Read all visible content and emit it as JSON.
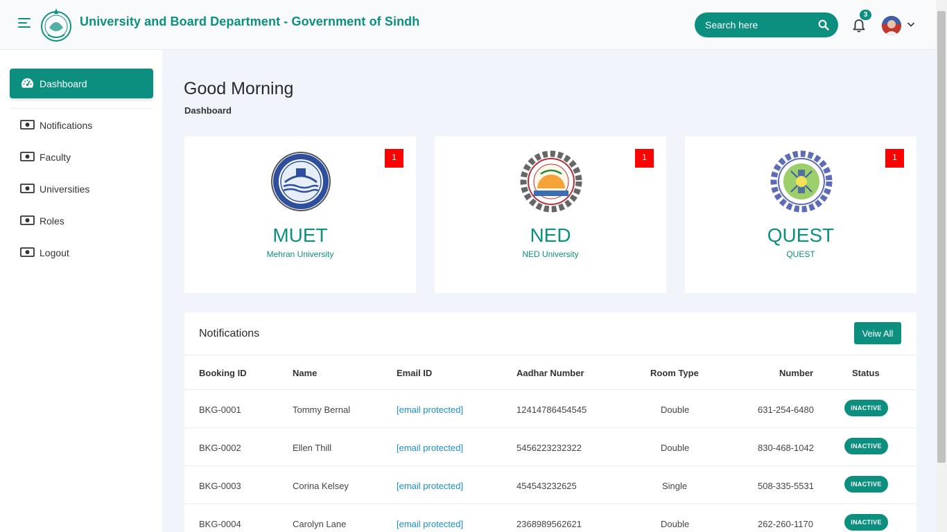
{
  "header": {
    "title": "University and Board Department - Government of Sindh",
    "search_placeholder": "Search here",
    "notification_count": "3"
  },
  "sidebar": {
    "items": [
      {
        "label": "Dashboard",
        "active": true
      },
      {
        "label": "Notifications"
      },
      {
        "label": "Faculty"
      },
      {
        "label": "Universities"
      },
      {
        "label": "Roles"
      },
      {
        "label": "Logout"
      }
    ]
  },
  "main": {
    "greeting": "Good Morning",
    "breadcrumb": "Dashboard"
  },
  "cards": [
    {
      "code": "MUET",
      "name": "Mehran University",
      "badge": "1"
    },
    {
      "code": "NED",
      "name": "NED University",
      "badge": "1"
    },
    {
      "code": "QUEST",
      "name": "QUEST",
      "badge": "1"
    }
  ],
  "notifications": {
    "title": "Notifications",
    "view_all": "Veiw All",
    "columns": [
      "Booking ID",
      "Name",
      "Email ID",
      "Aadhar Number",
      "Room Type",
      "Number",
      "Status"
    ],
    "rows": [
      [
        "BKG-0001",
        "Tommy Bernal",
        "[email protected]",
        "12414786454545",
        "Double",
        "631-254-6480",
        "INACTIVE"
      ],
      [
        "BKG-0002",
        "Ellen Thill",
        "[email protected]",
        "5456223232322",
        "Double",
        "830-468-1042",
        "INACTIVE"
      ],
      [
        "BKG-0003",
        "Corina Kelsey",
        "[email protected]",
        "454543232625",
        "Single",
        "508-335-5531",
        "INACTIVE"
      ],
      [
        "BKG-0004",
        "Carolyn Lane",
        "[email protected]",
        "2368989562621",
        "Double",
        "262-260-1170",
        "INACTIVE"
      ]
    ]
  },
  "colors": {
    "accent": "#0d8f7f",
    "badge": "#ff0000",
    "link": "#1a8fc4"
  }
}
